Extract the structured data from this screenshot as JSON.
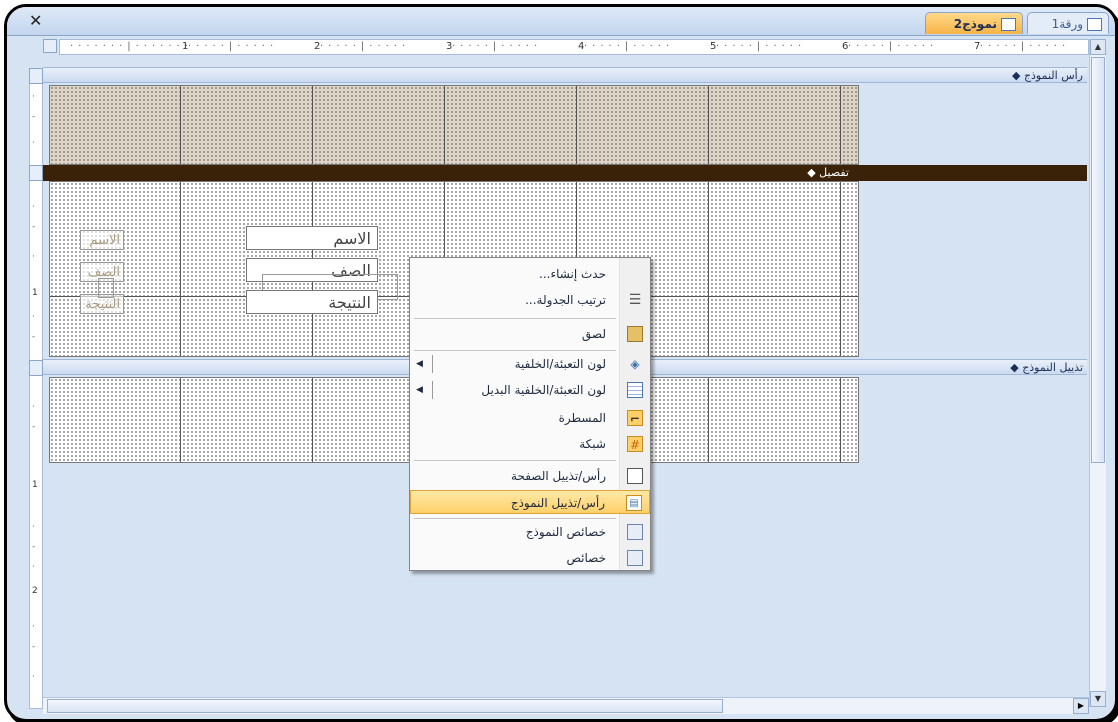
{
  "tabs": [
    {
      "label": "نموذج2",
      "active": true
    },
    {
      "label": "ورقة1",
      "active": false
    }
  ],
  "ruler": {
    "h_numbers": [
      "1",
      "2",
      "3",
      "4",
      "5",
      "6",
      "7"
    ],
    "v_numbers": [
      "1",
      "1",
      "2"
    ]
  },
  "sections": {
    "form_header": "رأس النموذج",
    "detail": "تفصيل",
    "form_footer": "تذييل النموذج"
  },
  "detail_controls": {
    "fields": [
      "الاسم",
      "الصف",
      "النتيجة"
    ],
    "labels": [
      "الاسم",
      "الصف",
      "النتيجة"
    ]
  },
  "context_menu": {
    "items": [
      {
        "label": "حدث إنشاء...",
        "icon": "",
        "submenu": false
      },
      {
        "label": "ترتيب الجدولة...",
        "icon": "tab-order-icon",
        "submenu": false
      },
      {
        "label": "لصق",
        "icon": "paste-icon",
        "submenu": false
      },
      {
        "label": "لون التعبئة/الخلفية",
        "icon": "fill-color-icon",
        "submenu": true
      },
      {
        "label": "لون التعبئة/الخلفية البديل",
        "icon": "alternate-fill-icon",
        "submenu": true
      },
      {
        "label": "المسطرة",
        "icon": "ruler-icon",
        "submenu": false
      },
      {
        "label": "شبكة",
        "icon": "grid-icon",
        "submenu": false
      },
      {
        "label": "رأس/تذييل الصفحة",
        "icon": "page-header-footer-icon",
        "submenu": false
      },
      {
        "label": "رأس/تذييل النموذج",
        "icon": "form-header-footer-icon",
        "submenu": false,
        "highlighted": true
      },
      {
        "label": "خصائص النموذج",
        "icon": "form-properties-icon",
        "submenu": false
      },
      {
        "label": "خصائص",
        "icon": "properties-icon",
        "submenu": false
      }
    ]
  },
  "colors": {
    "active_tab": "#f7b346",
    "detail_bar": "#3a2208",
    "highlight": "#ffd06a",
    "background": "#d6e3f3"
  }
}
